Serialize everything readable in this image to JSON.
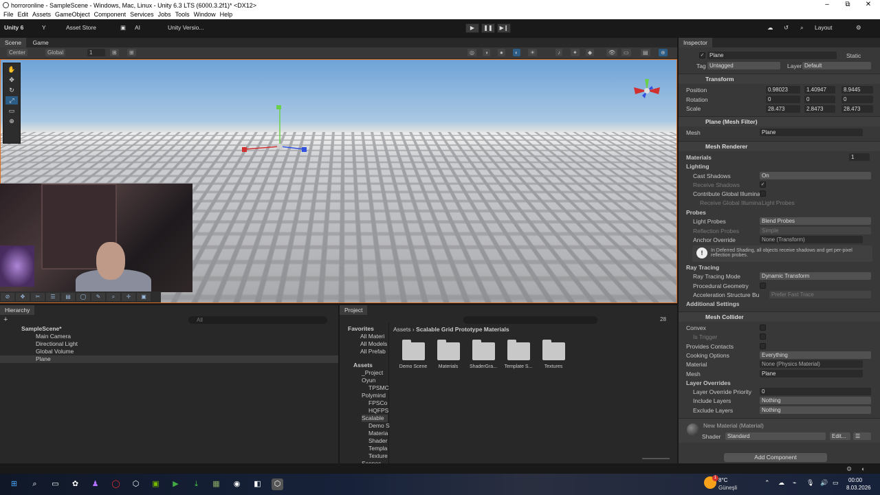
{
  "window": {
    "title": "horroronline - SampleScene - Windows, Mac, Linux - Unity 6.3 LTS (6000.3.2f1)* <DX12>",
    "minimize": "–",
    "maximize": "⧉",
    "close": "✕"
  },
  "menu": [
    "File",
    "Edit",
    "Assets",
    "GameObject",
    "Component",
    "Services",
    "Jobs",
    "Tools",
    "Window",
    "Help"
  ],
  "toolbar": {
    "unity": "Unity 6",
    "account": "Y",
    "asset_store": "Asset Store",
    "ai": "AI",
    "version": "Unity Versio...",
    "layout": "Layout",
    "play": "▶",
    "pause": "❚❚",
    "step": "▶❙"
  },
  "scene_panel": {
    "tab_scene": "Scene",
    "tab_game": "Game",
    "center": "Center",
    "global": "Global",
    "grid_step": "1"
  },
  "hierarchy": {
    "title": "Hierarchy",
    "search": "All",
    "scene": "SampleScene*",
    "items": [
      "Main Camera",
      "Directional Light",
      "Global Volume",
      "Plane"
    ]
  },
  "project": {
    "title": "Project",
    "breadcrumb_root": "Assets",
    "breadcrumb_leaf": "Scalable Grid Prototype Materials",
    "count": "28",
    "tree": [
      "Favorites",
      "All Materi",
      "All Models",
      "All Prefab",
      "Assets",
      "_Project",
      "Oyun",
      "TPSMC",
      "Polymind",
      "FPSCo",
      "HQFPS",
      "Scalable",
      "Demo S",
      "Materia",
      "Shader",
      "Templa",
      "Texture",
      "Scenes"
    ],
    "folders": [
      "Demo Scene",
      "Materials",
      "ShaderGra...",
      "Template S...",
      "Textures"
    ]
  },
  "inspector": {
    "title": "Inspector",
    "object_name": "Plane",
    "static": "Static",
    "tag_label": "Tag",
    "tag": "Untagged",
    "layer_label": "Layer",
    "layer": "Default",
    "transform": {
      "title": "Transform",
      "position_label": "Position",
      "rotation_label": "Rotation",
      "scale_label": "Scale",
      "px": "0.98023",
      "py": "1.40947",
      "pz": "8.9445",
      "rx": "0",
      "ry": "0",
      "rz": "0",
      "sx": "28.473",
      "sy": "2.8473",
      "sz": "28.473"
    },
    "mesh_filter": {
      "title": "Plane (Mesh Filter)",
      "mesh_label": "Mesh",
      "mesh": "Plane"
    },
    "mesh_renderer": {
      "title": "Mesh Renderer",
      "materials": "Materials",
      "materials_count": "1",
      "lighting": "Lighting",
      "cast_shadows_label": "Cast Shadows",
      "cast_shadows": "On",
      "receive_shadows": "Receive Shadows",
      "contribute_gi": "Contribute Global Illumina",
      "receive_gi": "Receive Global Illumina",
      "receive_gi_value": "Light Probes",
      "probes": "Probes",
      "light_probes_label": "Light Probes",
      "light_probes": "Blend Probes",
      "reflection_probes_label": "Reflection Probes",
      "reflection_probes": "Simple",
      "anchor_label": "Anchor Override",
      "anchor": "None (Transform)",
      "info": "In Deferred Shading, all objects receive shadows and get per-pixel reflection probes.",
      "ray_tracing": "Ray Tracing",
      "rt_mode_label": "Ray Tracing Mode",
      "rt_mode": "Dynamic Transform",
      "procedural": "Procedural Geometry",
      "accel_label": "Acceleration Structure Bu",
      "accel": "Prefer Fast Trace",
      "additional": "Additional Settings"
    },
    "mesh_collider": {
      "title": "Mesh Collider",
      "convex": "Convex",
      "is_trigger": "Is Trigger",
      "provides_contacts": "Provides Contacts",
      "cooking_label": "Cooking Options",
      "cooking": "Everything",
      "material_label": "Material",
      "material": "None (Physics Material)",
      "mesh_label": "Mesh",
      "mesh": "Plane",
      "layer_overrides": "Layer Overrides",
      "priority_label": "Layer Override Priority",
      "priority": "0",
      "include_label": "Include Layers",
      "include": "Nothing",
      "exclude_label": "Exclude Layers",
      "exclude": "Nothing"
    },
    "material": {
      "name": "New Material (Material)",
      "shader_label": "Shader",
      "shader": "Standard",
      "edit": "Edit..."
    },
    "add_component": "Add Component"
  },
  "taskbar": {
    "temp": "8°C",
    "weather": "Güneşli",
    "time": "00:00",
    "date": "8.03.2026",
    "weather_badge": "1"
  },
  "colors": {
    "accent": "#e07020",
    "selection": "#2c5d87",
    "bg": "#383838"
  }
}
